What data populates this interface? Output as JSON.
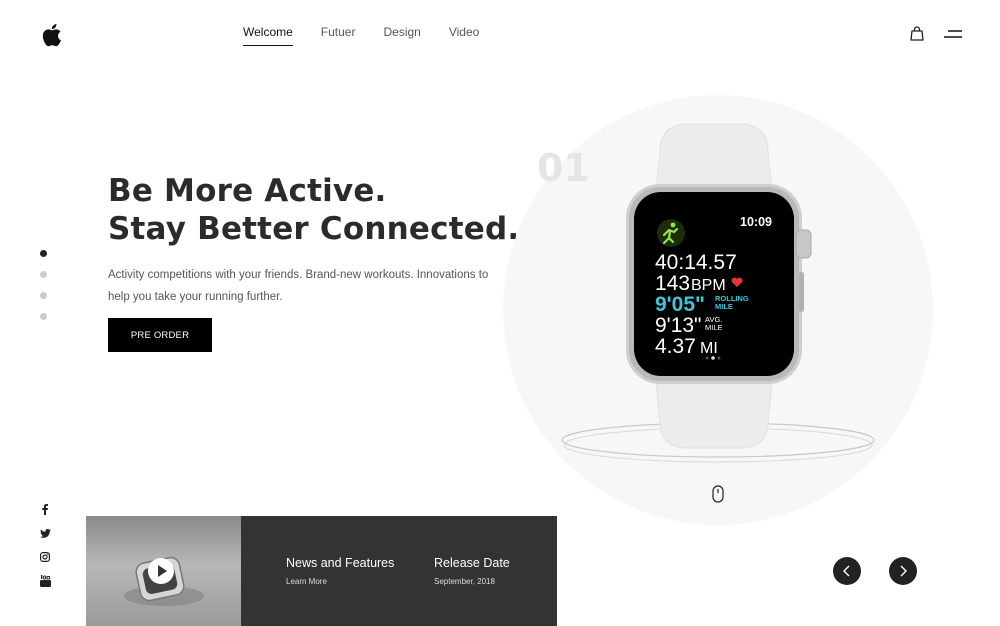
{
  "nav": {
    "items": [
      {
        "label": "Welcome",
        "active": true
      },
      {
        "label": "Futuer",
        "active": false
      },
      {
        "label": "Design",
        "active": false
      },
      {
        "label": "Video",
        "active": false
      }
    ]
  },
  "icons": {
    "logo": "apple-logo",
    "cart": "shopping-bag-icon",
    "menu": "hamburger-icon",
    "scroll": "mouse-scroll-icon"
  },
  "hero": {
    "title_line1": "Be More Active.",
    "title_line2": "Stay Better Connected.",
    "description": "Activity competitions with your friends. Brand-new workouts. Innovations to help you take your running further.",
    "cta_label": "PRE ORDER"
  },
  "slider": {
    "current": 1,
    "total": 4,
    "number": "01"
  },
  "social": [
    "facebook-icon",
    "twitter-icon",
    "instagram-icon",
    "youtube-icon"
  ],
  "watch_screen": {
    "time": "10:09",
    "duration": "40:14.57",
    "heart_rate": "143",
    "heart_unit": "BPM",
    "rolling_pace": "9'05\"",
    "rolling_label_1": "ROLLING",
    "rolling_label_2": "MILE",
    "avg_pace": "9'13\"",
    "avg_label_1": "AVG.",
    "avg_label_2": "MILE",
    "distance": "4.37",
    "distance_unit": "MI"
  },
  "news": {
    "title": "News and Features",
    "link": "Learn More",
    "release_title": "Release Date",
    "release_date": "September, 2018"
  },
  "colors": {
    "accent": "#000000",
    "panel": "#333333",
    "pace": "#3ec6d9",
    "heart": "#e53935",
    "workout": "#9be34b"
  }
}
